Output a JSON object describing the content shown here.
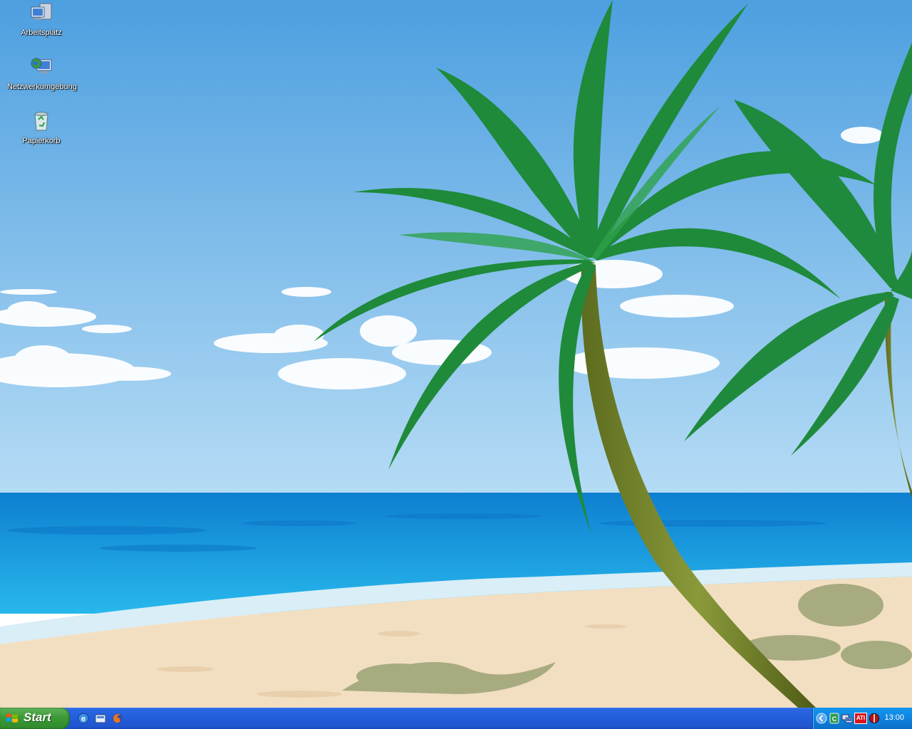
{
  "desktop": {
    "icons": [
      {
        "label": "Arbeitsplatz",
        "icon": "my-computer-icon"
      },
      {
        "label": "Netzwerkumgebung",
        "icon": "network-places-icon"
      },
      {
        "label": "Papierkorb",
        "icon": "recycle-bin-icon"
      }
    ],
    "wallpaper": "tropical beach with palm trees",
    "colors": {
      "sky_top": "#4d9fe0",
      "sky_bottom": "#b6dcf5",
      "sea": "#1aa6e6",
      "sand": "#f2dfc2",
      "palm_green": "#1e8a3a"
    }
  },
  "taskbar": {
    "start_label": "Start",
    "quick_launch": [
      "internet-explorer-icon",
      "show-desktop-icon",
      "firefox-icon"
    ],
    "tray": {
      "icons": [
        "tray-expand-arrow-icon",
        "security-shield-icon",
        "network-icon",
        "ati-catalyst-icon",
        "antivirus-icon"
      ],
      "ati_text": "ATI",
      "clock": "13:00"
    },
    "colors": {
      "bar": "#245ddb",
      "start": "#3c9a36",
      "tray": "#0f83e0"
    }
  }
}
